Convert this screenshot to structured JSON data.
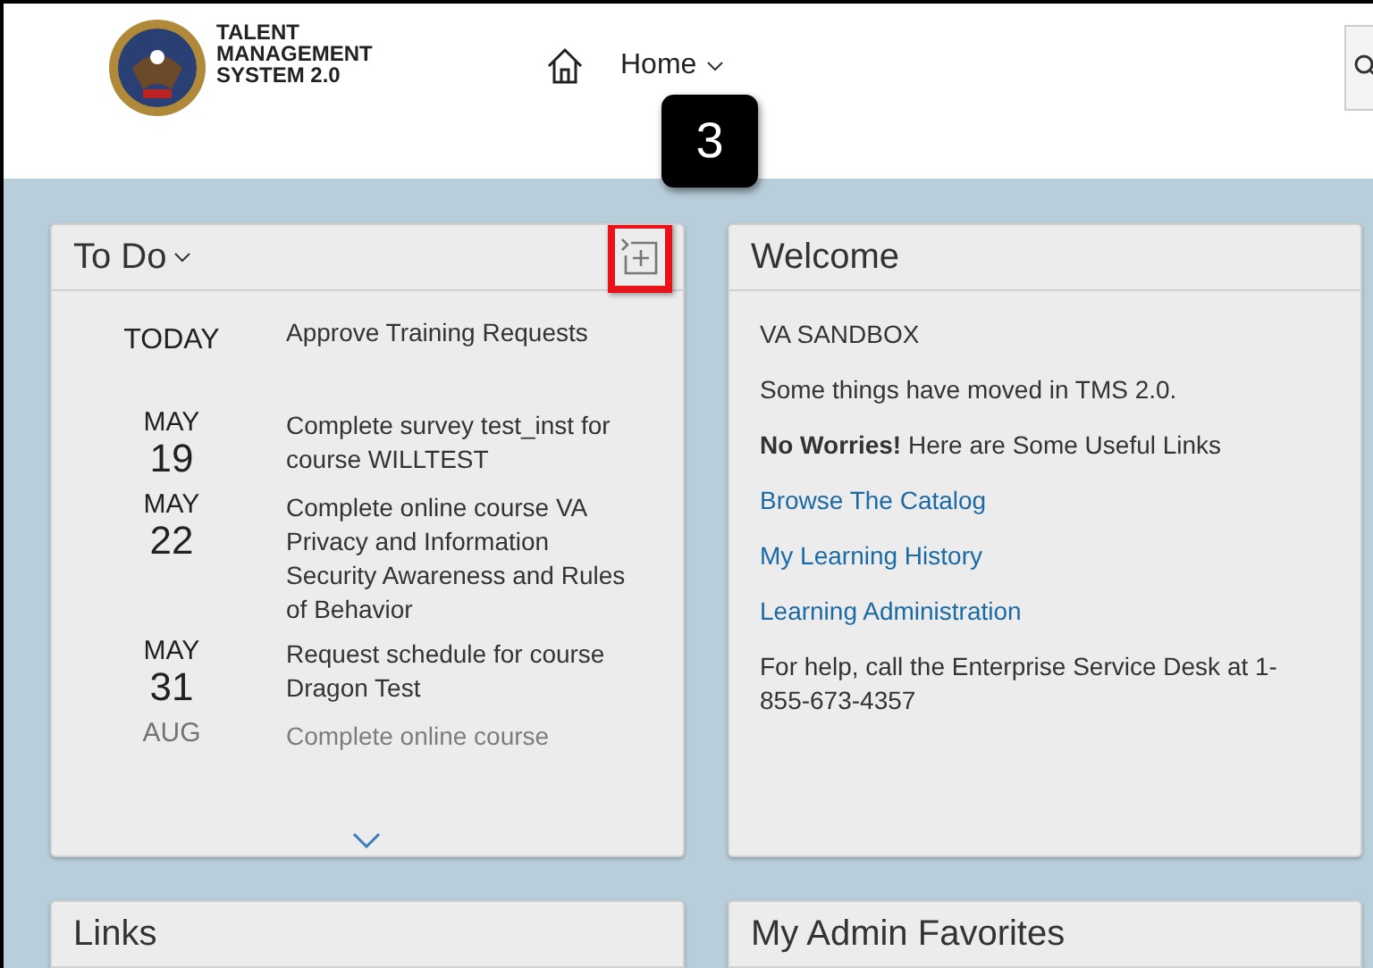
{
  "header": {
    "logo_text": "TALENT MANAGEMENT SYSTEM 2.0",
    "nav": {
      "label": "Home"
    }
  },
  "callout": {
    "label": "3"
  },
  "todo": {
    "title": "To Do",
    "add_button": {
      "highlighted": true
    },
    "items": [
      {
        "kind": "today",
        "date": "TODAY",
        "text": "Approve Training Requests"
      },
      {
        "kind": "dated",
        "month": "MAY",
        "day": "19",
        "text": "Complete survey test_inst for course WILLTEST"
      },
      {
        "kind": "dated",
        "month": "MAY",
        "day": "22",
        "text": "Complete online course VA Privacy and Information Security Awareness and Rules of Behavior"
      },
      {
        "kind": "dated",
        "month": "MAY",
        "day": "31",
        "text": "Request schedule for course Dragon Test"
      },
      {
        "kind": "dated",
        "month": "AUG",
        "text": "Complete online course"
      }
    ]
  },
  "welcome": {
    "title": "Welcome",
    "lines": [
      {
        "kind": "text",
        "text": "VA SANDBOX"
      },
      {
        "kind": "text",
        "text": "Some things have moved in TMS 2.0."
      },
      {
        "kind": "text",
        "text": "**No Worries!** Here are Some Useful Links"
      },
      {
        "kind": "link",
        "text": "Browse The Catalog"
      },
      {
        "kind": "link",
        "text": "My Learning History"
      },
      {
        "kind": "link",
        "text": "Learning Administration"
      },
      {
        "kind": "text",
        "text": "For help, call the Enterprise Service Desk at 1-855-673-4357"
      }
    ]
  },
  "cards": [
    {
      "title": "Links"
    },
    {
      "title": "My Admin Favorites"
    }
  ]
}
